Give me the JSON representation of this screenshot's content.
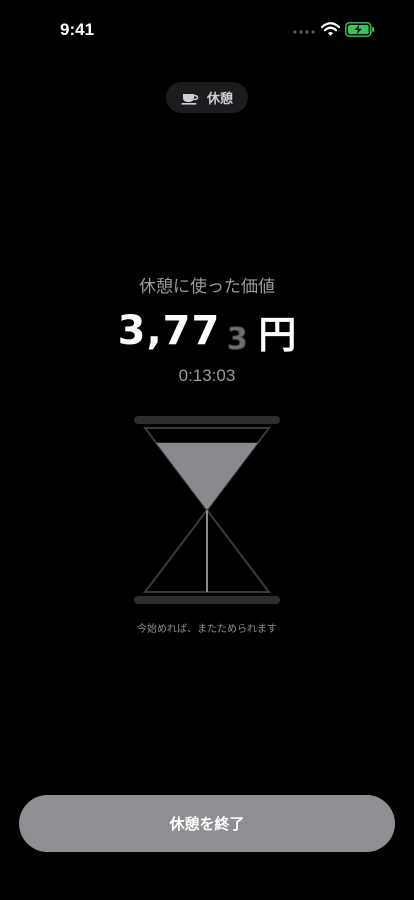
{
  "status_bar": {
    "time": "9:41",
    "signal_icon": "signal-dots-icon",
    "wifi_icon": "wifi-icon",
    "battery_icon": "battery-charging-icon",
    "battery_color": "#34c759"
  },
  "mode_pill": {
    "icon": "coffee-cup-icon",
    "label": "休憩"
  },
  "summary": {
    "caption": "休憩に使った価値",
    "amount_main": "3,77",
    "amount_rolling_digit": "3",
    "currency": "円",
    "elapsed": "0:13:03"
  },
  "hourglass": {
    "icon": "hourglass-icon",
    "top_fill_fraction": 0.82,
    "sand_color": "#8a8a8e"
  },
  "hint": "今始めれば、またためられます",
  "end_button": {
    "label": "休憩を終了",
    "color": "#8e8e93"
  }
}
